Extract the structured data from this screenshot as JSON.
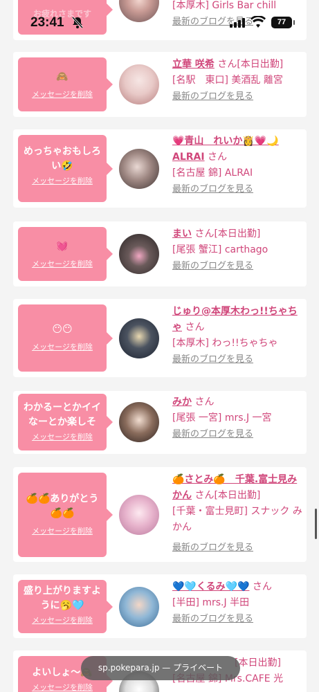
{
  "status": {
    "time": "23:41",
    "battery": "77"
  },
  "delete_label": "メッセージを削除",
  "blog_label": "最新のブログを見る",
  "san": "さん",
  "top_partial": {
    "message": "お疲れさまです",
    "info": "[本厚木] Girls Bar chill"
  },
  "cards": [
    {
      "message": "🙈",
      "name": "立華 咲希",
      "extra": "[本日出勤]",
      "shop": "[名駅　東口] 美酒乱 離宮"
    },
    {
      "message": "めっちゃおもしろい🤣",
      "name": "💗青山　れいか👸💗🌙ALRAI",
      "extra": "",
      "shop": "[名古屋 錦] ALRAI"
    },
    {
      "message": "💓",
      "name": "まい",
      "extra": "[本日出勤]",
      "shop": "[尾張 蟹江] carthago"
    },
    {
      "message": "😶😶",
      "name": "じゅり@本厚木わっ!!ちゃちゃ",
      "extra": "",
      "shop": "[本厚木] わっ!!ちゃちゃ"
    },
    {
      "message": "わかるーとかイイなーとか楽しそ",
      "name": "みか",
      "extra": "",
      "shop": "[尾張 一宮] mrs.J 一宮"
    },
    {
      "message": "🍊🍊ありがとう🍊🍊",
      "name": "🍊さとみ🍊　千葉.富士見みかん",
      "extra": "[本日出勤]",
      "shop": "[千葉・富士見町] スナック みかん"
    },
    {
      "message": "盛り上がりますように🥱🩵",
      "name": "💙🩵くるみ🩵💙",
      "extra": "",
      "shop": "[半田] mrs.J 半田"
    },
    {
      "message": "よいしょ〜🙈",
      "name": "",
      "extra": "[本日出勤]",
      "shop": "[名古屋 錦] Mrs.CAFE 光"
    }
  ],
  "url_bar": {
    "domain": "sp.pokepara.jp",
    "suffix": "— プライベート"
  },
  "colors": {
    "accent_pink": "#f88ea5",
    "link_pink": "#d0467a"
  }
}
